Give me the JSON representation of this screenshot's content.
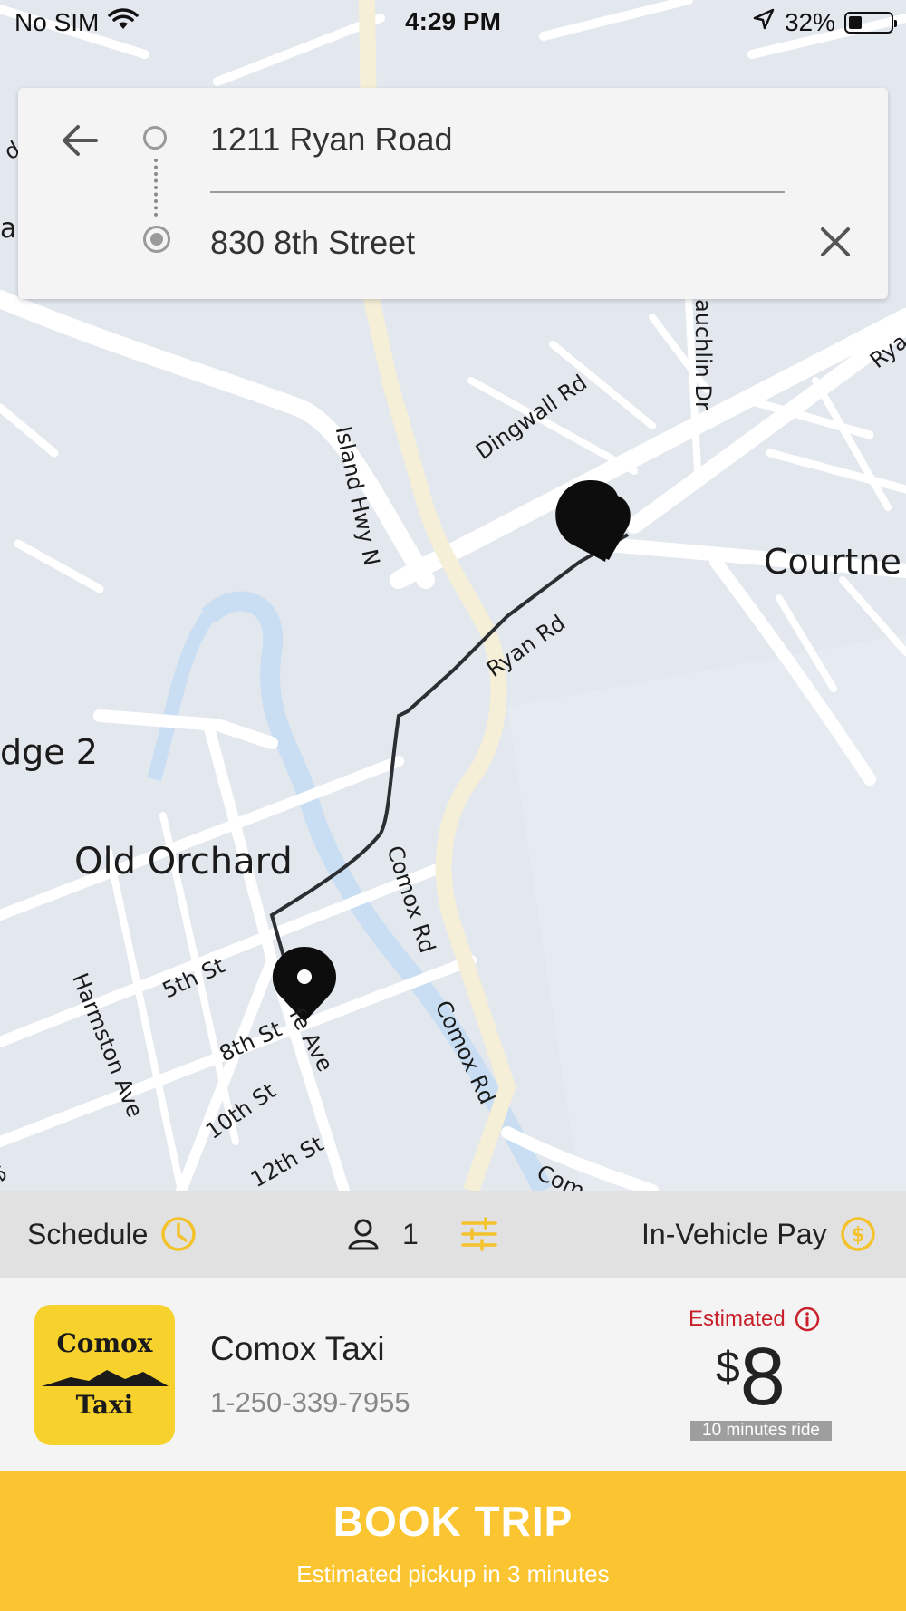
{
  "status_bar": {
    "carrier": "No SIM",
    "time": "4:29 PM",
    "battery": "32%"
  },
  "trip": {
    "origin": "1211 Ryan Road",
    "destination": "830 8th Street"
  },
  "map": {
    "labels": {
      "island_hwy": "Island Hwy N",
      "dingwall": "Dingwall Rd",
      "mclauchlin": "auchlin Dr",
      "ryan_top": "Rya",
      "courtenay": "Courtne",
      "ryan_rd": "Ryan Rd",
      "ridge2": "dge 2",
      "old_orchard": "Old Orchard",
      "comox_rd_1": "Comox Rd",
      "comox_rd_2": "Comox Rd",
      "comox_bottom": "Com",
      "fifth": "5th St",
      "eighth": "8th St",
      "fife": "fe Ave",
      "harmston": "Harmston Ave",
      "tenth": "10th St",
      "twelfth": "12th St",
      "ave_edge": "ve",
      "left_d": "d",
      "left_a": "a"
    }
  },
  "options": {
    "schedule_label": "Schedule",
    "passengers": "1",
    "payment_label": "In-Vehicle Pay"
  },
  "provider": {
    "logo_line1": "Comox",
    "logo_line2": "Taxi",
    "name": "Comox Taxi",
    "phone": "1-250-339-7955",
    "estimated_label": "Estimated",
    "currency": "$",
    "price": "8",
    "ride_time": "10 minutes ride"
  },
  "book": {
    "title": "BOOK TRIP",
    "subtitle": "Estimated pickup in 3 minutes"
  },
  "colors": {
    "accent_yellow": "#fbc531",
    "estimate_red": "#c8202a",
    "map_bg": "#e3e8ef",
    "water": "#c9def2",
    "highway": "#f4efd6"
  }
}
